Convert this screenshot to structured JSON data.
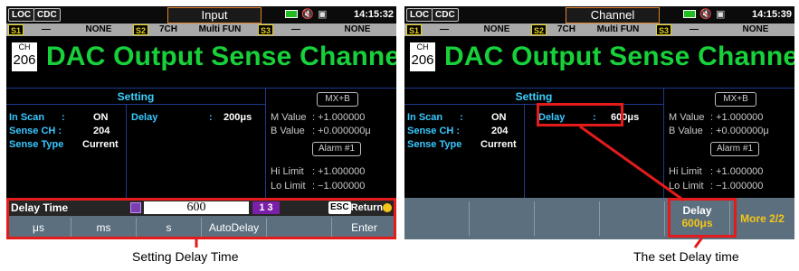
{
  "left": {
    "status": {
      "loc": "LOC",
      "cdc": "CDC",
      "title": "Input",
      "time": "14:15:32"
    },
    "slots": {
      "s1": "S1",
      "s1_val": "—",
      "none1": "NONE",
      "s2": "S2",
      "s2_ch": "7CH",
      "s2_mode": "Multi FUN",
      "s3": "S3",
      "s3_val": "—",
      "none2": "NONE"
    },
    "ch_label": "CH",
    "ch_num": "206",
    "headline": "DAC Output Sense Channel",
    "setting_header": "Setting",
    "rows": [
      {
        "label": "In Scan",
        "colon": ":",
        "value": "ON"
      },
      {
        "label": "Sense CH :",
        "colon": "",
        "value": "204"
      },
      {
        "label": "Sense Type",
        "colon": "",
        "value": "Current"
      }
    ],
    "delay_label": "Delay",
    "delay_colon": ":",
    "delay_value": "200μs",
    "mxb": "MX+B",
    "m_label": "M Value",
    "m_value": ": +1.000000",
    "b_label": "B Value",
    "b_value": ": +0.000000μ",
    "alarm": "Alarm #1",
    "hi_label": "Hi Limit",
    "hi_value": ": +1.000000",
    "lo_label": "Lo Limit",
    "lo_value": ": −1.000000",
    "input": {
      "label": "Delay Time",
      "value": "600",
      "digits": "1 3",
      "esc": "ESC",
      "esc_text": ":Return"
    },
    "softkeys": [
      "μs",
      "ms",
      "s",
      "AutoDelay",
      "",
      "Enter"
    ]
  },
  "right": {
    "status": {
      "loc": "LOC",
      "cdc": "CDC",
      "title": "Channel",
      "time": "14:15:39"
    },
    "slots": {
      "s1": "S1",
      "s1_val": "—",
      "none1": "NONE",
      "s2": "S2",
      "s2_ch": "7CH",
      "s2_mode": "Multi FUN",
      "s3": "S3",
      "s3_val": "—",
      "none2": "NONE"
    },
    "ch_label": "CH",
    "ch_num": "206",
    "headline": "DAC Output Sense Channel",
    "setting_header": "Setting",
    "rows": [
      {
        "label": "In Scan",
        "colon": ":",
        "value": "ON"
      },
      {
        "label": "Sense CH :",
        "colon": "",
        "value": "204"
      },
      {
        "label": "Sense Type",
        "colon": "",
        "value": "Current"
      }
    ],
    "delay_label": "Delay",
    "delay_colon": ":",
    "delay_value": "600μs",
    "mxb": "MX+B",
    "m_label": "M Value",
    "m_value": ": +1.000000",
    "b_label": "B Value",
    "b_value": ": +0.000000μ",
    "alarm": "Alarm #1",
    "hi_label": "Hi Limit",
    "hi_value": ": +1.000000",
    "lo_label": "Lo Limit",
    "lo_value": ": −1.000000",
    "softkey_delay_label": "Delay",
    "softkey_delay_value": "600μs",
    "more": "More 2/2"
  },
  "captions": {
    "left": "Setting Delay Time",
    "right": "The set Delay time"
  },
  "colors": {
    "headline": "#18d13a",
    "label": "#39c7ff",
    "highlight": "#e31b1b",
    "softkey_value": "#f5c518",
    "title_border": "#e0822a"
  }
}
